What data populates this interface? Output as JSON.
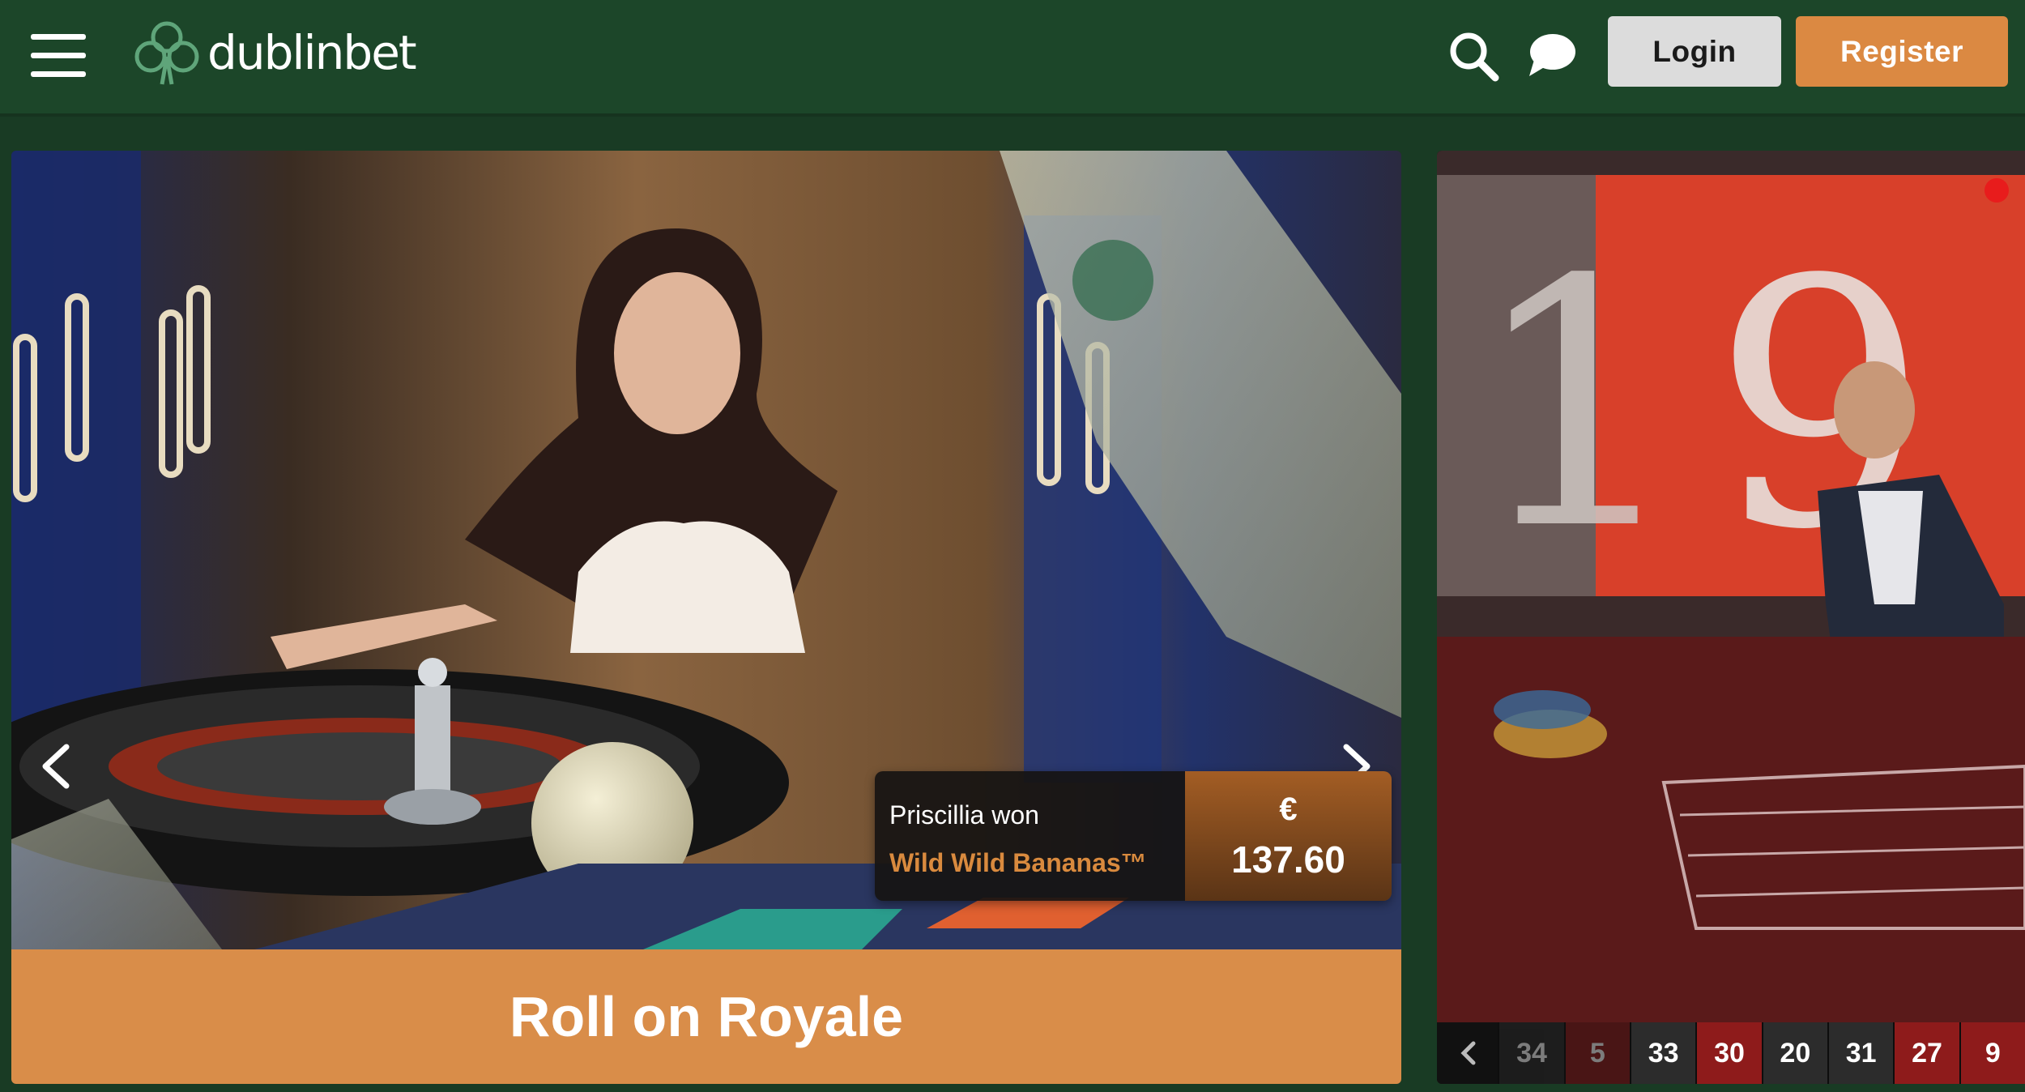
{
  "header": {
    "logo_text": "dublinbet",
    "login_label": "Login",
    "register_label": "Register",
    "colors": {
      "bar": "#1c4629",
      "accent": "#db8942",
      "login_bg": "#dcdcdc"
    },
    "icons": [
      "menu-icon",
      "clover-logo-icon",
      "search-icon",
      "chat-icon"
    ]
  },
  "hero": {
    "title": "Roll on Royale",
    "win_card": {
      "winner_text": "Priscillia won",
      "game_name": "Wild Wild Bananas™",
      "currency": "€",
      "amount": "137.60"
    },
    "colors": {
      "title_bar": "#d98d49"
    }
  },
  "side_tile": {
    "recent_results": [
      {
        "value": "34",
        "color": "black",
        "faded": true
      },
      {
        "value": "5",
        "color": "red",
        "faded": true
      },
      {
        "value": "33",
        "color": "black",
        "faded": false
      },
      {
        "value": "30",
        "color": "red",
        "faded": false
      },
      {
        "value": "20",
        "color": "black",
        "faded": false
      },
      {
        "value": "31",
        "color": "black",
        "faded": false
      },
      {
        "value": "27",
        "color": "red",
        "faded": false
      },
      {
        "value": "9",
        "color": "red",
        "faded": false
      }
    ]
  }
}
